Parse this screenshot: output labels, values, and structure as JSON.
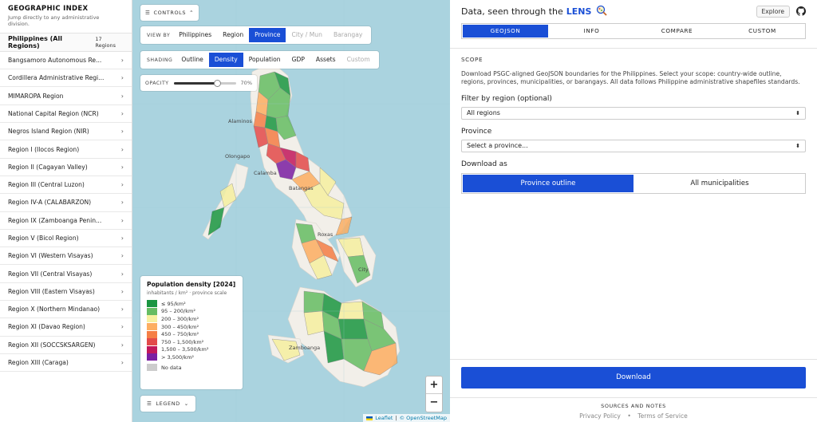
{
  "sidebar": {
    "title": "GEOGRAPHIC INDEX",
    "subtitle": "Jump directly to any administrative division.",
    "all_label": "Philippines (All Regions)",
    "all_count": "17 Regions",
    "items": [
      {
        "label": "Bangsamoro Autonomous Re..."
      },
      {
        "label": "Cordillera Administrative Regi..."
      },
      {
        "label": "MIMAROPA Region"
      },
      {
        "label": "National Capital Region (NCR)"
      },
      {
        "label": "Negros Island Region (NIR)"
      },
      {
        "label": "Region I (Ilocos Region)"
      },
      {
        "label": "Region II (Cagayan Valley)"
      },
      {
        "label": "Region III (Central Luzon)"
      },
      {
        "label": "Region IV-A (CALABARZON)"
      },
      {
        "label": "Region IX (Zamboanga Penin..."
      },
      {
        "label": "Region V (Bicol Region)"
      },
      {
        "label": "Region VI (Western Visayas)"
      },
      {
        "label": "Region VII (Central Visayas)"
      },
      {
        "label": "Region VIII (Eastern Visayas)"
      },
      {
        "label": "Region X (Northern Mindanao)"
      },
      {
        "label": "Region XI (Davao Region)"
      },
      {
        "label": "Region XII (SOCCSKSARGEN)"
      },
      {
        "label": "Region XIII (Caraga)"
      }
    ]
  },
  "map": {
    "controls_label": "CONTROLS",
    "view_by": {
      "label": "VIEW BY",
      "options": [
        "Philippines",
        "Region",
        "Province",
        "City / Mun",
        "Barangay"
      ],
      "active": "Province"
    },
    "shading": {
      "label": "SHADING",
      "options": [
        "Outline",
        "Density",
        "Population",
        "GDP",
        "Assets",
        "Custom"
      ],
      "active": "Density"
    },
    "opacity": {
      "label": "OPACITY",
      "value": 70,
      "value_text": "70%"
    },
    "legend": {
      "title": "Population density [2024]",
      "subtitle": "inhabitants / km² · province scale",
      "entries": [
        {
          "label": "≤ 95/km²",
          "color": "#1a9641"
        },
        {
          "label": "95 – 200/km²",
          "color": "#66bd63"
        },
        {
          "label": "200 – 300/km²",
          "color": "#f6f0a0"
        },
        {
          "label": "300 – 450/km²",
          "color": "#fdae61"
        },
        {
          "label": "450 – 750/km²",
          "color": "#f57e45"
        },
        {
          "label": "750 – 1,500/km²",
          "color": "#e34a4a"
        },
        {
          "label": "1,500 – 3,500/km²",
          "color": "#c2185b"
        },
        {
          "label": "> 3,500/km²",
          "color": "#7b1fa2"
        }
      ],
      "no_data_label": "No data",
      "no_data_color": "#cccccc"
    },
    "legend_button": "LEGEND",
    "zoom_in": "+",
    "zoom_out": "−",
    "attribution": {
      "leaflet": "Leaflet",
      "sep": "|",
      "copyright": "© OpenStreetMap"
    },
    "place_labels": [
      "Alaminos",
      "Olongapo",
      "Calamba",
      "Batangas",
      "Roxas",
      "City",
      "Zamboanga"
    ]
  },
  "right": {
    "title": "Data, seen through the",
    "brand": "LENS",
    "explore_label": "Explore",
    "tabs": [
      {
        "label": "GEOJSON",
        "active": true
      },
      {
        "label": "INFO",
        "active": false
      },
      {
        "label": "COMPARE",
        "active": false
      },
      {
        "label": "CUSTOM",
        "active": false
      }
    ],
    "scope_heading": "SCOPE",
    "description": "Download PSGC-aligned GeoJSON boundaries for the Philippines. Select your scope: country-wide outline, regions, provinces, municipalities, or barangays. All data follows Philippine administrative shapefiles standards.",
    "filter_label": "Filter by region (optional)",
    "region_select_value": "All regions",
    "province_label": "Province",
    "province_select_value": "Select a province...",
    "download_as_label": "Download as",
    "download_options": [
      {
        "label": "Province outline",
        "active": true
      },
      {
        "label": "All municipalities",
        "active": false
      }
    ],
    "download_button": "Download",
    "sources_label": "SOURCES AND NOTES",
    "footer_links": [
      "Privacy Policy",
      "Terms of Service"
    ],
    "footer_sep": "•"
  },
  "colors": {
    "accent": "#1a4fd6",
    "water": "#aad3df",
    "land": "#f2efe9"
  }
}
